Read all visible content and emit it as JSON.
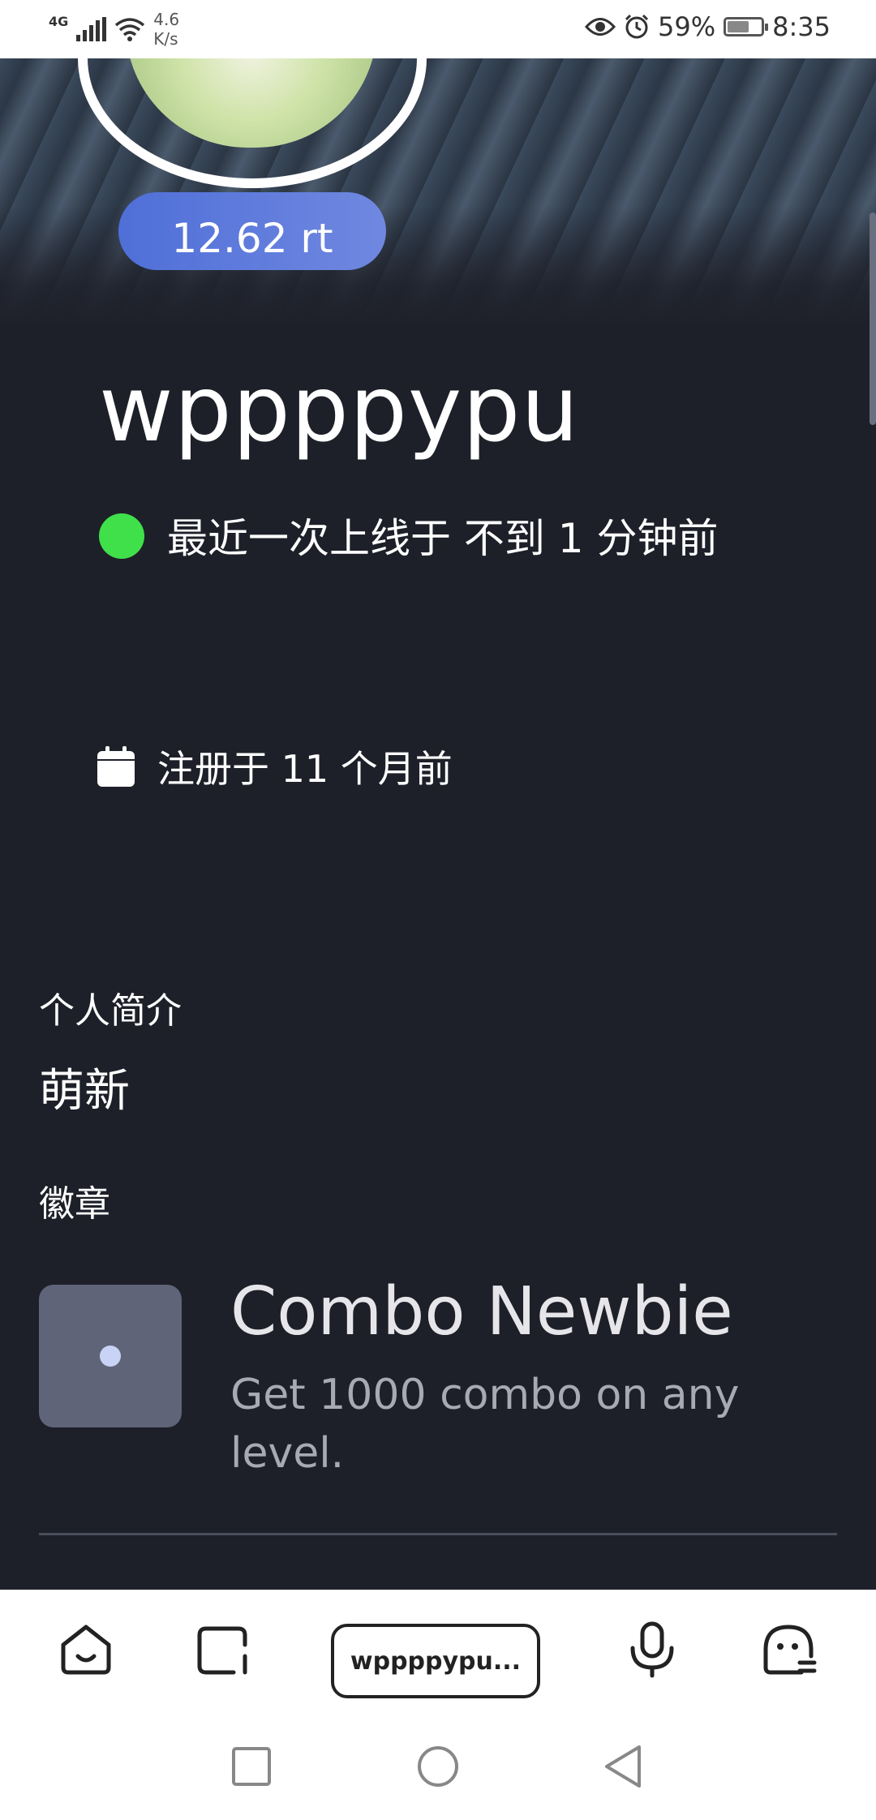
{
  "status_bar": {
    "network": "4G",
    "speed_value": "4.6",
    "speed_unit": "K/s",
    "battery": "59%",
    "time": "8:35"
  },
  "profile": {
    "rating": "12.62 rt",
    "username": "wppppypu",
    "online_status": "最近一次上线于 不到 1 分钟前",
    "online_color": "#3fe04a",
    "registered": "注册于 11 个月前",
    "bio_label": "个人简介",
    "bio": "萌新",
    "badges_label": "徽章",
    "badges": [
      {
        "title": "Combo Newbie",
        "description": "Get 1000 combo on any level."
      }
    ]
  },
  "toolbar": {
    "url": "wppppypu..."
  },
  "colors": {
    "background": "#1e2029",
    "accent": "#5a78dc"
  }
}
